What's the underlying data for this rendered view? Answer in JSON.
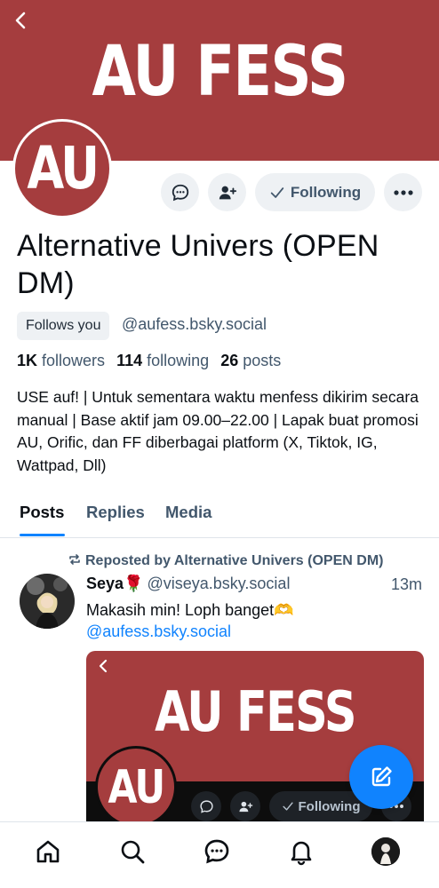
{
  "banner": {
    "text": "AU FESS"
  },
  "avatar": {
    "text": "AU"
  },
  "actions": {
    "following_label": "Following"
  },
  "profile": {
    "display_name": "Alternative Univers (OPEN DM)",
    "follows_you": "Follows you",
    "handle": "@aufess.bsky.social",
    "followers_count": "1K",
    "followers_label": "followers",
    "following_count": "114",
    "following_label": "following",
    "posts_count": "26",
    "posts_label": "posts",
    "bio": "USE auf! | Untuk sementara waktu menfess dikirim secara manual | Base aktif jam 09.00–22.00 | Lapak buat promosi AU, Orific, dan FF diberbagai platform (X, Tiktok, IG, Wattpad, Dll)"
  },
  "tabs": [
    {
      "label": "Posts",
      "active": true
    },
    {
      "label": "Replies",
      "active": false
    },
    {
      "label": "Media",
      "active": false
    }
  ],
  "post": {
    "repost_label": "Reposted by Alternative Univers (OPEN DM)",
    "author_name": "Seya🌹",
    "author_handle": "@viseya.bsky.social",
    "time": "13m",
    "text": "Makasih min! Loph banget🫶",
    "mention": "@aufess.bsky.social",
    "embed": {
      "banner_text": "AU FESS",
      "avatar_text": "AU",
      "following_label": "Following"
    }
  },
  "colors": {
    "brand_red": "#a53d3e",
    "accent_blue": "#1083fe",
    "muted": "#42576c",
    "chip_bg": "#eef1f4"
  },
  "icons": {
    "back": "chevron-left-icon",
    "message": "chat-bubble-icon",
    "add_user": "user-plus-icon",
    "following_check": "checkmark-icon",
    "more": "ellipsis-icon",
    "repost": "repost-icon",
    "compose": "compose-icon",
    "nav": [
      "home-icon",
      "search-icon",
      "chat-icon",
      "bell-icon",
      "profile-avatar"
    ]
  }
}
